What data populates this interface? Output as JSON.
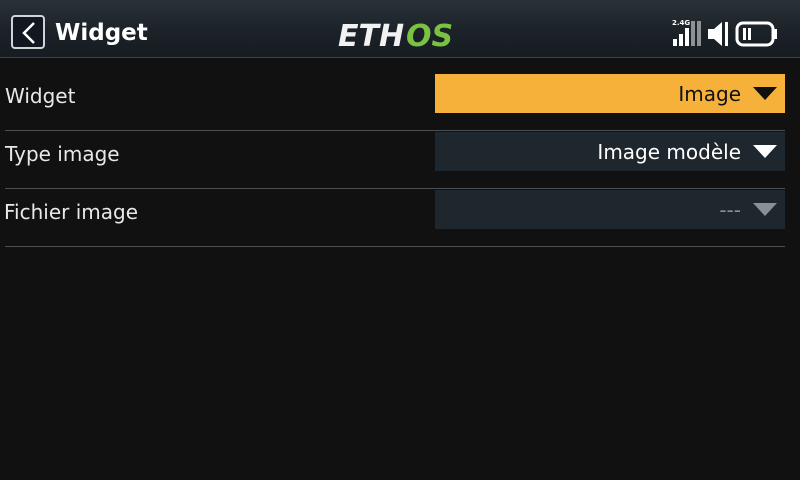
{
  "header": {
    "title": "Widget",
    "back_icon": "chevron-left-icon",
    "logo": {
      "left": "ETH",
      "right": "OS",
      "color_left": "#f2f2f2",
      "color_right": "#7cc242"
    },
    "status": {
      "band_label": "2.4G",
      "icons": [
        "signal-bars-icon",
        "speaker-icon",
        "battery-icon"
      ]
    }
  },
  "settings": [
    {
      "label": "Widget",
      "value": "Image",
      "state": "selected"
    },
    {
      "label": "Type image",
      "value": "Image modèle",
      "state": "normal"
    },
    {
      "label": "Fichier image",
      "value": "---",
      "state": "disabled"
    }
  ],
  "colors": {
    "background": "#111111",
    "highlight": "#f6b13b",
    "field": "#1e272e",
    "divider": "#4a4f53"
  }
}
